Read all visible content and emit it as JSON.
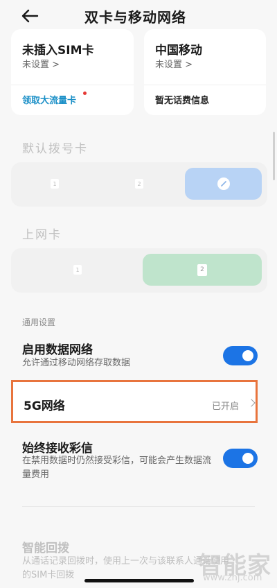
{
  "header": {
    "title": "双卡与移动网络",
    "back_icon": "arrow-left-icon"
  },
  "sim_cards": [
    {
      "title": "未插入SIM卡",
      "subtitle": "未设置 >",
      "action": "领取大流量卡"
    },
    {
      "title": "中国移动",
      "subtitle": "未设置 >",
      "info": "暂无话费信息"
    }
  ],
  "default_dial": {
    "label": "默认拨号卡",
    "options": [
      "1",
      "2"
    ],
    "selected_icon": "pencil-icon"
  },
  "data_card": {
    "label": "上网卡",
    "options": [
      "1",
      "2"
    ],
    "selected": "2"
  },
  "general": {
    "section_label": "通用设置",
    "data_network": {
      "title": "启用数据网络",
      "subtitle": "允许通过移动网络存取数据",
      "enabled": true
    },
    "g5": {
      "title": "5G网络",
      "value": "已开启"
    },
    "mms": {
      "title": "始终接收彩信",
      "subtitle": "在禁用数据时仍然接受彩信，可能会产生数据流量费用",
      "enabled": true
    },
    "smart_callback": {
      "title": "智能回拨",
      "subtitle": "从通话记录回拨时，使用上一次与该联系人通话使用的SIM卡回拨"
    }
  },
  "watermark": {
    "big": "智能家",
    "small": "www.znj.com"
  },
  "colors": {
    "accent": "#1c74e5",
    "highlight": "#e8743d",
    "link": "#1a8fc7"
  }
}
